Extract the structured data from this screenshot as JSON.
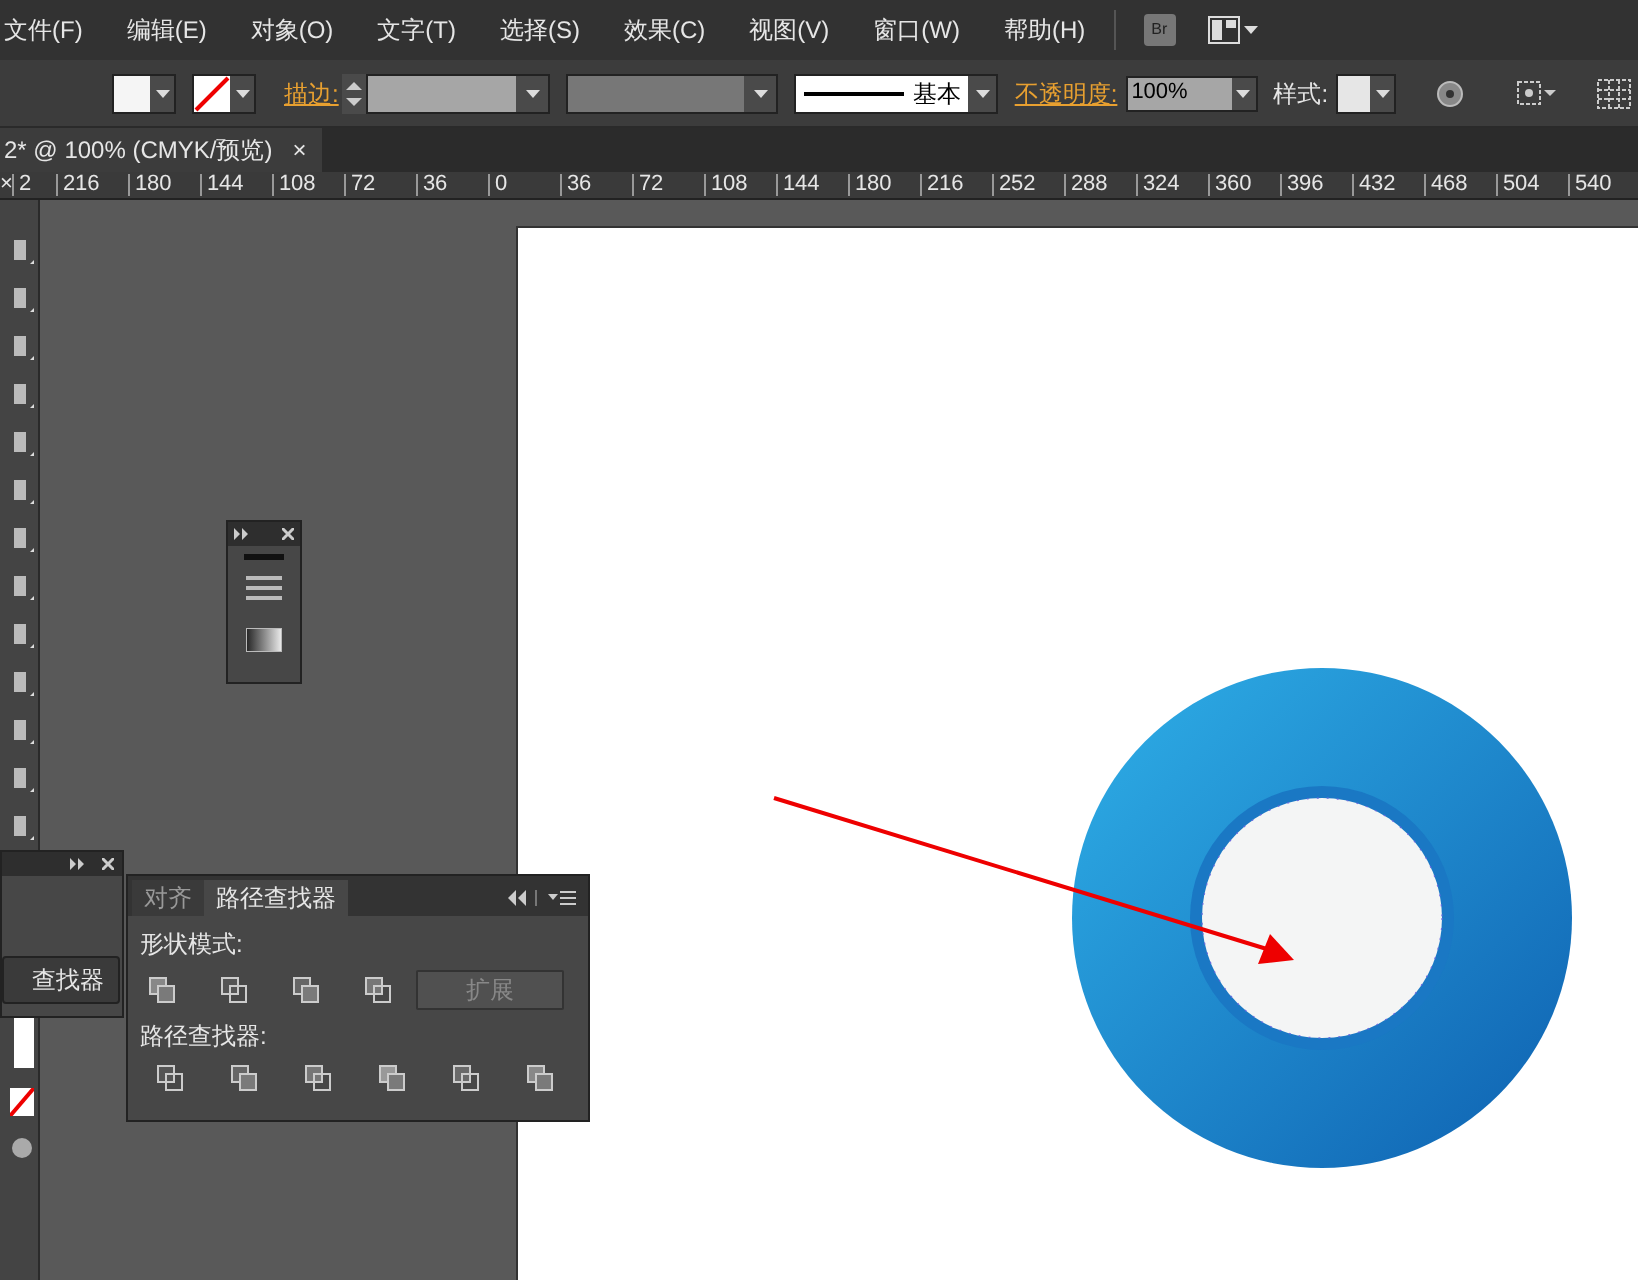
{
  "menu_bar": {
    "items": [
      "文件(F)",
      "编辑(E)",
      "对象(O)",
      "文字(T)",
      "选择(S)",
      "效果(C)",
      "视图(V)",
      "窗口(W)",
      "帮助(H)"
    ],
    "bridge_button": "Br"
  },
  "control_bar": {
    "stroke_label": "描边:",
    "stroke_style": "基本",
    "opacity_label": "不透明度:",
    "opacity_value": "100%",
    "style_label": "样式:"
  },
  "document_tab": {
    "title": "2* @ 100% (CMYK/预览)",
    "close": "×"
  },
  "ruler": {
    "close": "×",
    "labels": [
      "2",
      "216",
      "180",
      "144",
      "108",
      "72",
      "36",
      "0",
      "36",
      "72",
      "108",
      "144",
      "180",
      "216",
      "252",
      "288",
      "324",
      "360",
      "396",
      "432",
      "468",
      "504",
      "540"
    ]
  },
  "collapsed_panel": {
    "button": "查找器"
  },
  "pathfinder_panel": {
    "tabs": [
      {
        "label": "对齐",
        "selected": false
      },
      {
        "label": "路径查找器",
        "selected": true
      }
    ],
    "shape_modes_label": "形状模式:",
    "expand_button": {
      "label": "扩展",
      "disabled": true
    },
    "pathfinders_label": "路径查找器:"
  }
}
